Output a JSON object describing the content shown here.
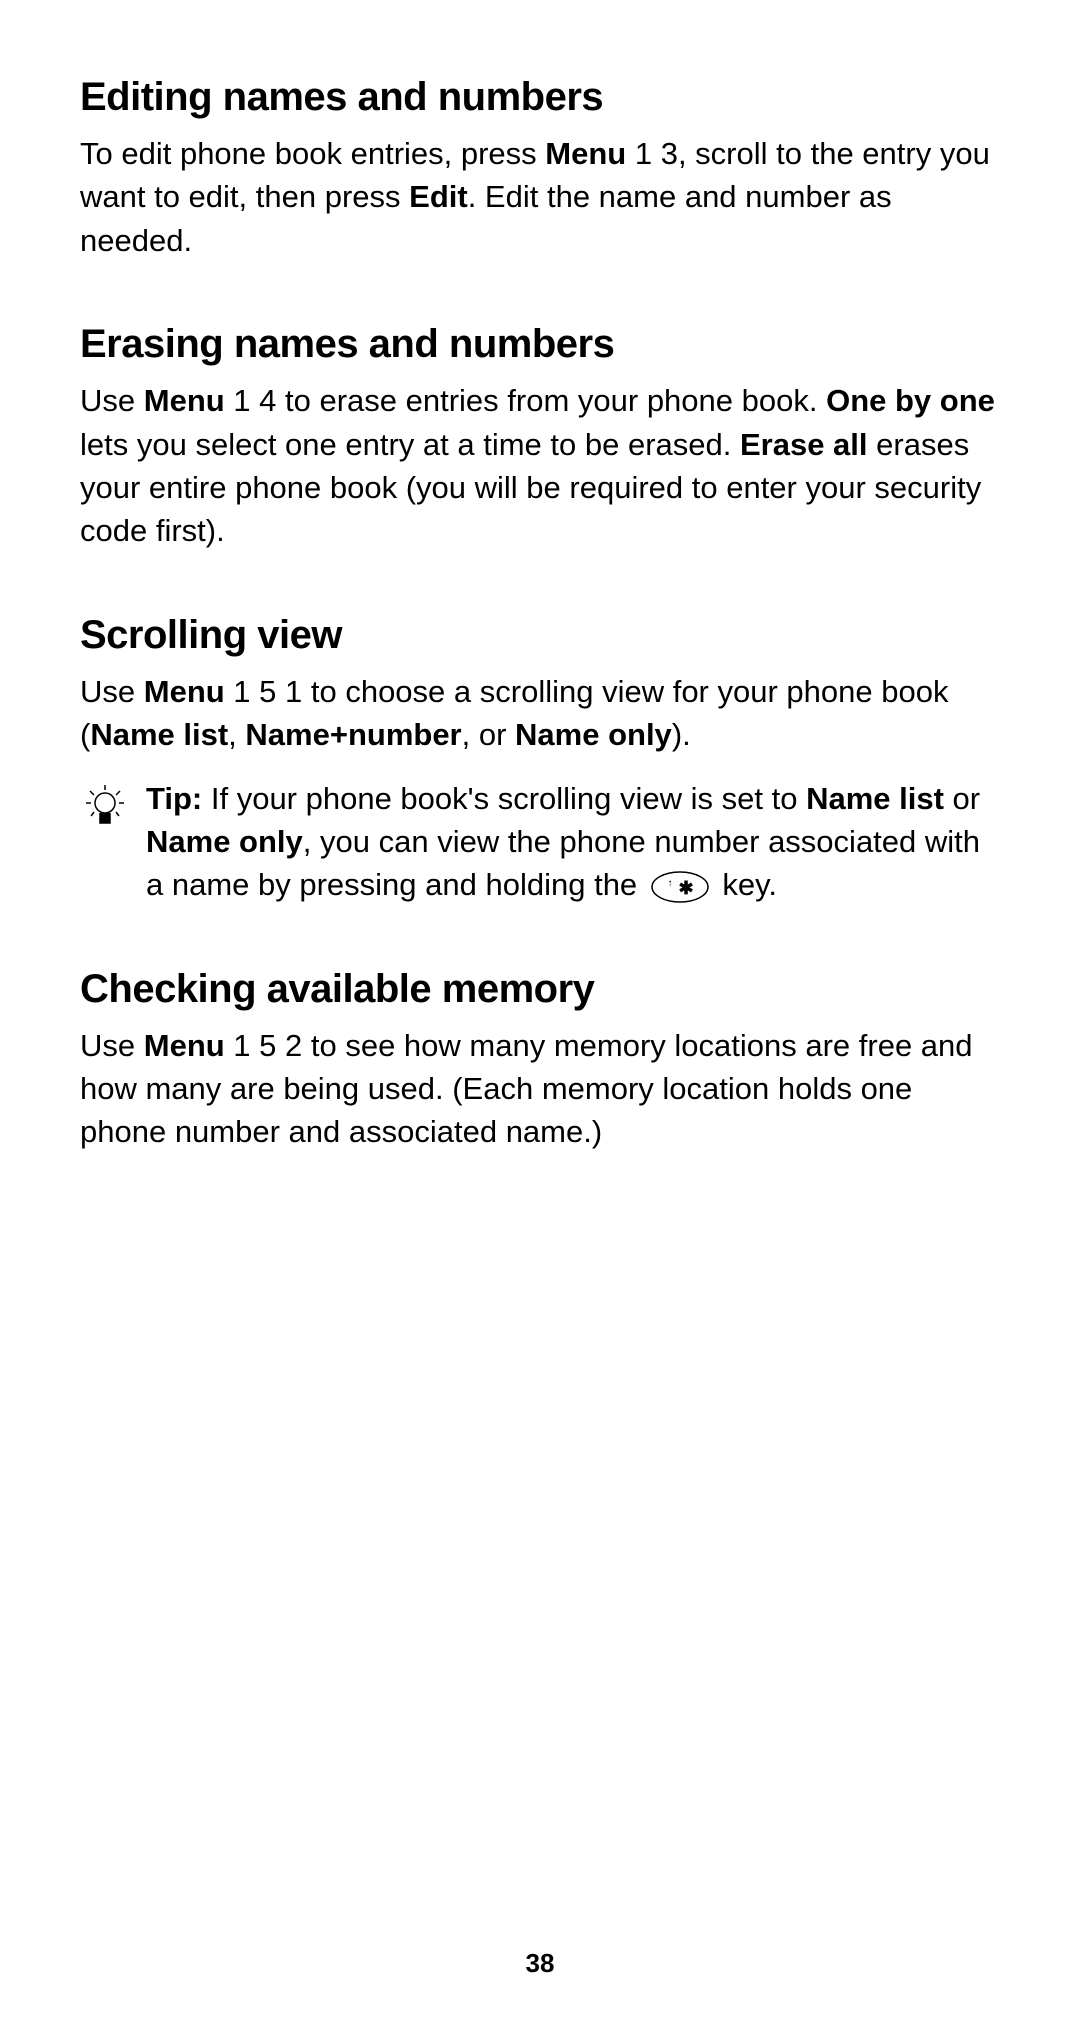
{
  "sections": {
    "editing": {
      "heading": "Editing names and numbers",
      "p1_a": "To edit phone book entries, press ",
      "p1_b": "Menu",
      "p1_c": " 1 3, scroll to the entry you want to edit, then press ",
      "p1_d": "Edit",
      "p1_e": ". Edit the name and number as needed."
    },
    "erasing": {
      "heading": "Erasing names and numbers",
      "p1_a": "Use ",
      "p1_b": "Menu",
      "p1_c": " 1 4 to erase entries from your phone book. ",
      "p1_d": "One by one",
      "p1_e": " lets you select one entry at a time to be erased. ",
      "p1_f": "Erase all",
      "p1_g": " erases your entire phone book (you will be required to enter your security code first)."
    },
    "scrolling": {
      "heading": "Scrolling view",
      "p1_a": "Use ",
      "p1_b": "Menu",
      "p1_c": " 1 5 1 to choose a scrolling view for your phone book (",
      "p1_d": "Name list",
      "p1_e": ", ",
      "p1_f": "Name+number",
      "p1_g": ", or ",
      "p1_h": "Name only",
      "p1_i": ").",
      "tip_label": "Tip:",
      "tip_a": "  If your phone book's scrolling view is set to ",
      "tip_b": "Name list",
      "tip_c": " or ",
      "tip_d": "Name only",
      "tip_e": ", you can view the phone number associated with a name by pressing and holding the ",
      "tip_f": " key."
    },
    "memory": {
      "heading": "Checking available memory",
      "p1_a": "Use ",
      "p1_b": "Menu",
      "p1_c": " 1 5 2 to see how many memory locations are free and how many are being used. (Each memory location holds one phone number and associated name.)"
    }
  },
  "page_number": "38"
}
